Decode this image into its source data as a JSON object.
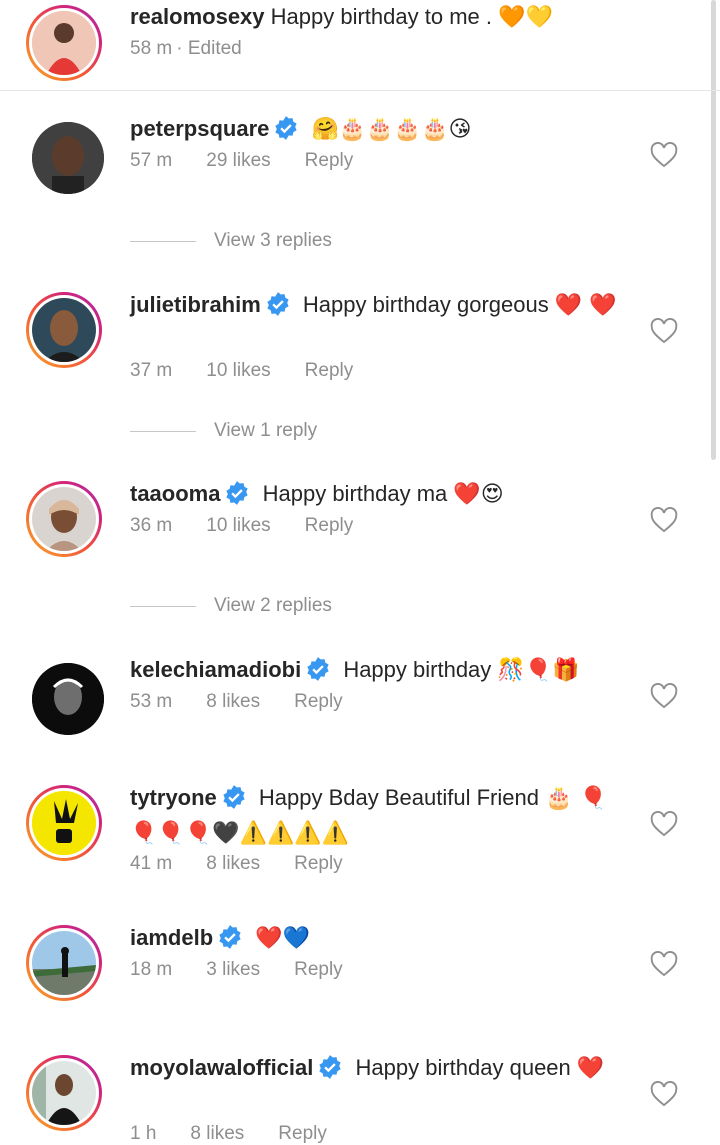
{
  "caption": {
    "username": "realomosexy",
    "text": "Happy birthday to me .",
    "emoji": "🧡💛",
    "time": "58 m",
    "edited": "· Edited"
  },
  "comments": [
    {
      "username": "peterpsquare",
      "text": "",
      "emoji": "🤗🎂🎂🎂🎂😘",
      "time": "57 m",
      "likes": "29 likes",
      "reply": "Reply",
      "view_replies": "View 3 replies"
    },
    {
      "username": "julietibrahim",
      "text": "Happy birthday gorgeous",
      "emoji": "❤️ ❤️",
      "time": "37 m",
      "likes": "10 likes",
      "reply": "Reply",
      "view_replies": "View 1 reply"
    },
    {
      "username": "taaooma",
      "text": "Happy birthday ma",
      "emoji": "❤️😍",
      "time": "36 m",
      "likes": "10 likes",
      "reply": "Reply",
      "view_replies": "View 2 replies"
    },
    {
      "username": "kelechiamadiobi",
      "text": "Happy birthday",
      "emoji": "🎊🎈🎁",
      "time": "53 m",
      "likes": "8 likes",
      "reply": "Reply"
    },
    {
      "username": "tytryone",
      "text": "Happy Bday Beautiful Friend",
      "emoji": "🎂 🎈🎈🎈🎈🖤⚠️⚠️⚠️⚠️",
      "time": "41 m",
      "likes": "8 likes",
      "reply": "Reply"
    },
    {
      "username": "iamdelb",
      "text": "",
      "emoji": "❤️💙",
      "time": "18 m",
      "likes": "3 likes",
      "reply": "Reply"
    },
    {
      "username": "moyolawalofficial",
      "text": "Happy birthday queen",
      "emoji": "❤️",
      "time": "1 h",
      "likes": "8 likes",
      "reply": "Reply"
    }
  ],
  "colors": {
    "username": "#262626",
    "meta": "#8e8e8e",
    "verified": "#3897f0",
    "heart_red": "#e0192b"
  }
}
